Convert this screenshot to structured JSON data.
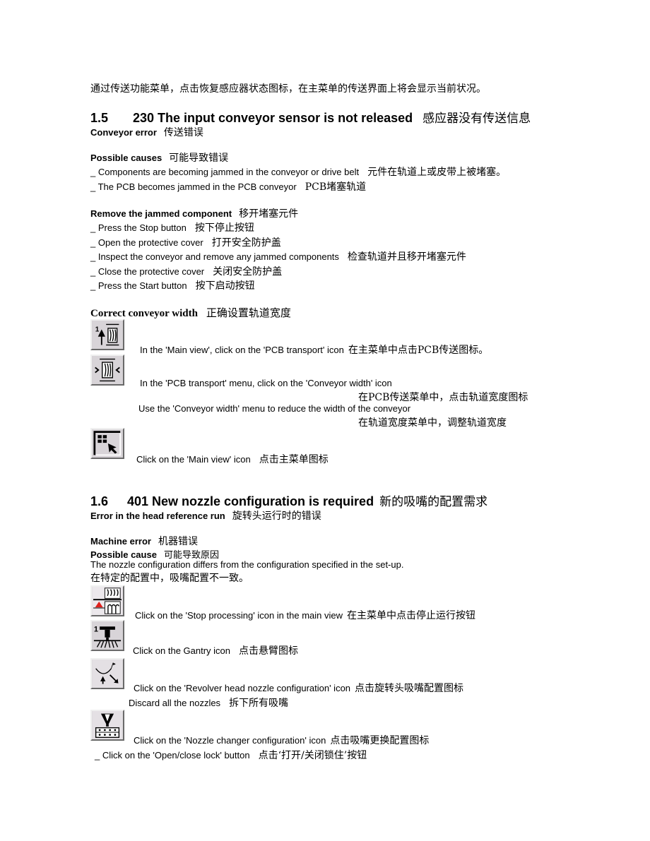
{
  "intro": "通过传送功能菜单，点击恢复感应器状态图标，在主菜单的传送界面上将会显示当前状况。",
  "section15": {
    "number": "1.5",
    "title": "230 The input conveyor sensor is not released",
    "title_cn": "感应器没有传送信息",
    "subtitle": "Conveyor error",
    "subtitle_cn": "传送错误",
    "causes_heading": "Possible causes",
    "causes_heading_cn": "可能导致错误",
    "causes": [
      {
        "en": "_ Components are becoming jammed in the conveyor or drive belt",
        "cn": "元件在轨道上或皮带上被堵塞。"
      },
      {
        "en": "_ The PCB becomes jammed in the PCB conveyor",
        "cn": "PCB堵塞轨道"
      }
    ],
    "remove_heading": "Remove the jammed component",
    "remove_heading_cn": "移开堵塞元件",
    "remove_steps": [
      {
        "en": "_ Press the Stop button",
        "cn": "按下停止按钮"
      },
      {
        "en": "_ Open the protective cover",
        "cn": "打开安全防护盖"
      },
      {
        "en": "_ Inspect the conveyor and remove any jammed components",
        "cn": "检查轨道并且移开堵塞元件"
      },
      {
        "en": "_ Close the protective cover",
        "cn": "关闭安全防护盖"
      },
      {
        "en": "_ Press the Start button",
        "cn": "按下启动按钮"
      }
    ],
    "width_heading": "Correct conveyor width",
    "width_heading_cn": "正确设置轨道宽度",
    "width_steps": [
      {
        "icon": "pcb-transport-icon",
        "en": "In the 'Main view', click on the 'PCB transport' icon",
        "cn": "在主菜单中点击PCB传送图标。"
      },
      {
        "icon": "conveyor-width-icon",
        "en": "In the 'PCB transport' menu, click on the 'Conveyor width' icon",
        "cn": "在PCB传送菜单中，点击轨道宽度图标"
      },
      {
        "en": "Use the 'Conveyor width' menu to reduce the width of the conveyor",
        "cn": "在轨道宽度菜单中，调整轨道宽度"
      },
      {
        "icon": "main-view-icon",
        "en": "Click on the 'Main view' icon",
        "cn": "点击主菜单图标"
      }
    ]
  },
  "section16": {
    "number": "1.6",
    "title": "401 New nozzle configuration is required",
    "title_cn": "新的吸嘴的配置需求",
    "subtitle": "Error in the head reference run",
    "subtitle_cn": "旋转头运行时的错误",
    "machine_error": "Machine error",
    "machine_error_cn": "机器错误",
    "cause_heading": "Possible cause",
    "cause_heading_cn": "可能导致原因",
    "cause_text": "The nozzle configuration differs from the configuration specified in the set-up.",
    "cause_text_cn": "在特定的配置中，吸嘴配置不一致。",
    "steps": [
      {
        "icon": "stop-processing-icon",
        "en": "Click on the 'Stop processing' icon in the main view",
        "cn": "在主菜单中点击停止运行按钮"
      },
      {
        "icon": "gantry-icon",
        "en": "Click on the Gantry icon",
        "cn": "点击悬臂图标"
      },
      {
        "icon": "revolver-head-icon",
        "en": "Click on the 'Revolver head nozzle configuration' icon",
        "cn": "点击旋转头吸嘴配置图标"
      },
      {
        "en": "Discard all the nozzles",
        "cn": "拆下所有吸嘴"
      },
      {
        "icon": "nozzle-changer-icon",
        "en": "Click on the 'Nozzle changer configuration' icon",
        "cn": "点击吸嘴更换配置图标"
      },
      {
        "en": "_ Click on the 'Open/close lock' button",
        "cn": "点击‘打开/关闭锁住’按钮"
      }
    ]
  },
  "colors": {
    "text": "#000000",
    "icon_face": "#c8c8c8",
    "alert_red": "#e0201c"
  }
}
